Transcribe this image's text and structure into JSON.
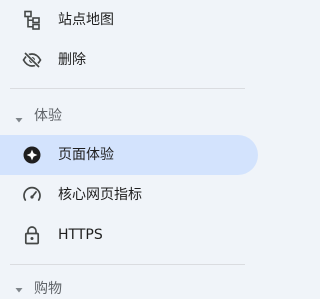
{
  "nav": {
    "items_top": [
      {
        "id": "sitemap",
        "label": "站点地图",
        "icon": "sitemap-icon"
      },
      {
        "id": "removals",
        "label": "删除",
        "icon": "eye-off-icon"
      }
    ],
    "section": {
      "label": "体验",
      "expanded": true
    },
    "section_items": [
      {
        "id": "page-experience",
        "label": "页面体验",
        "icon": "page-experience-icon",
        "active": true
      },
      {
        "id": "core-web-vitals",
        "label": "核心网页指标",
        "icon": "speedometer-icon",
        "active": false
      },
      {
        "id": "https",
        "label": "HTTPS",
        "icon": "lock-icon",
        "active": false
      }
    ],
    "next_section": {
      "label": "购物"
    }
  },
  "colors": {
    "background": "#f0f4f9",
    "active_background": "#d3e3fd",
    "text": "#1f1f1f",
    "muted_text": "#5f6368",
    "divider": "#dadce0",
    "icon": "#444746"
  }
}
